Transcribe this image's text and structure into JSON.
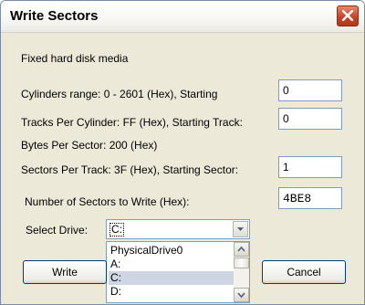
{
  "window": {
    "title": "Write Sectors",
    "close_icon": "close-icon"
  },
  "media_label": "Fixed hard disk media",
  "rows": {
    "cylinders_label": "Cylinders range: 0 - 2601 (Hex), Starting",
    "cylinders_value": "0",
    "tracks_label": "Tracks Per Cylinder:  FF (Hex), Starting Track:",
    "tracks_value": "0",
    "bytes_label": "Bytes Per Sector:  200 (Hex)",
    "sectors_label": "Sectors Per Track:  3F (Hex), Starting Sector:",
    "sectors_value": "1",
    "count_label": "Number of Sectors to Write (Hex):",
    "count_value": "4BE8"
  },
  "drive": {
    "label": "Select Drive:",
    "selected": "C:",
    "options": [
      "PhysicalDrive0",
      "A:",
      "C:",
      "D:"
    ],
    "highlighted_option": "C:"
  },
  "buttons": {
    "write": "Write",
    "cancel": "Cancel"
  },
  "colors": {
    "accent": "#7f9db9",
    "close": "#c8442a",
    "dialog_bg": "#ece9d8",
    "highlight": "#cfd6e3"
  }
}
